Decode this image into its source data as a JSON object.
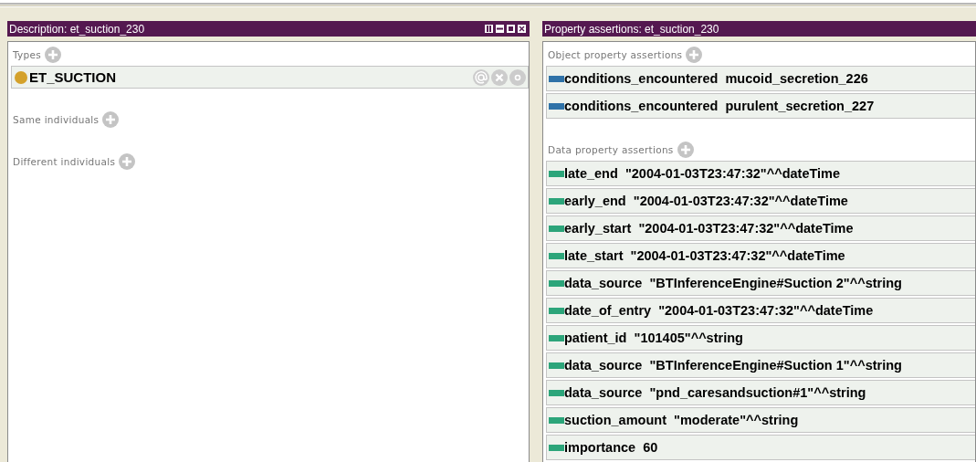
{
  "description_panel": {
    "title": "Description: et_suction_230",
    "sections": [
      {
        "kind": "types",
        "label": "Types",
        "rows": [
          {
            "text": "ET_SUCTION"
          }
        ]
      },
      {
        "label": "Same individuals"
      },
      {
        "label": "Different individuals"
      }
    ]
  },
  "property_panel": {
    "title": "Property assertions: et_suction_230",
    "sections": [
      {
        "kind": "object",
        "label": "Object property assertions",
        "rows": [
          {
            "text": "conditions_encountered  mucoid_secretion_226"
          },
          {
            "text": "conditions_encountered  purulent_secretion_227"
          }
        ]
      },
      {
        "kind": "data",
        "label": "Data property assertions",
        "rows": [
          {
            "text": "late_end  \"2004-01-03T23:47:32\"^^dateTime"
          },
          {
            "text": "early_end  \"2004-01-03T23:47:32\"^^dateTime"
          },
          {
            "text": "early_start  \"2004-01-03T23:47:32\"^^dateTime"
          },
          {
            "text": "late_start  \"2004-01-03T23:47:32\"^^dateTime"
          },
          {
            "text": "data_source  \"BTInferenceEngine#Suction 2\"^^string"
          },
          {
            "text": "date_of_entry  \"2004-01-03T23:47:32\"^^dateTime"
          },
          {
            "text": "patient_id  \"101405\"^^string"
          },
          {
            "text": "data_source  \"BTInferenceEngine#Suction 1\"^^string"
          },
          {
            "text": "data_source  \"pnd_caresandsuction#1\"^^string"
          },
          {
            "text": "suction_amount  \"moderate\"^^string"
          },
          {
            "text": "importance  60"
          }
        ]
      }
    ]
  }
}
